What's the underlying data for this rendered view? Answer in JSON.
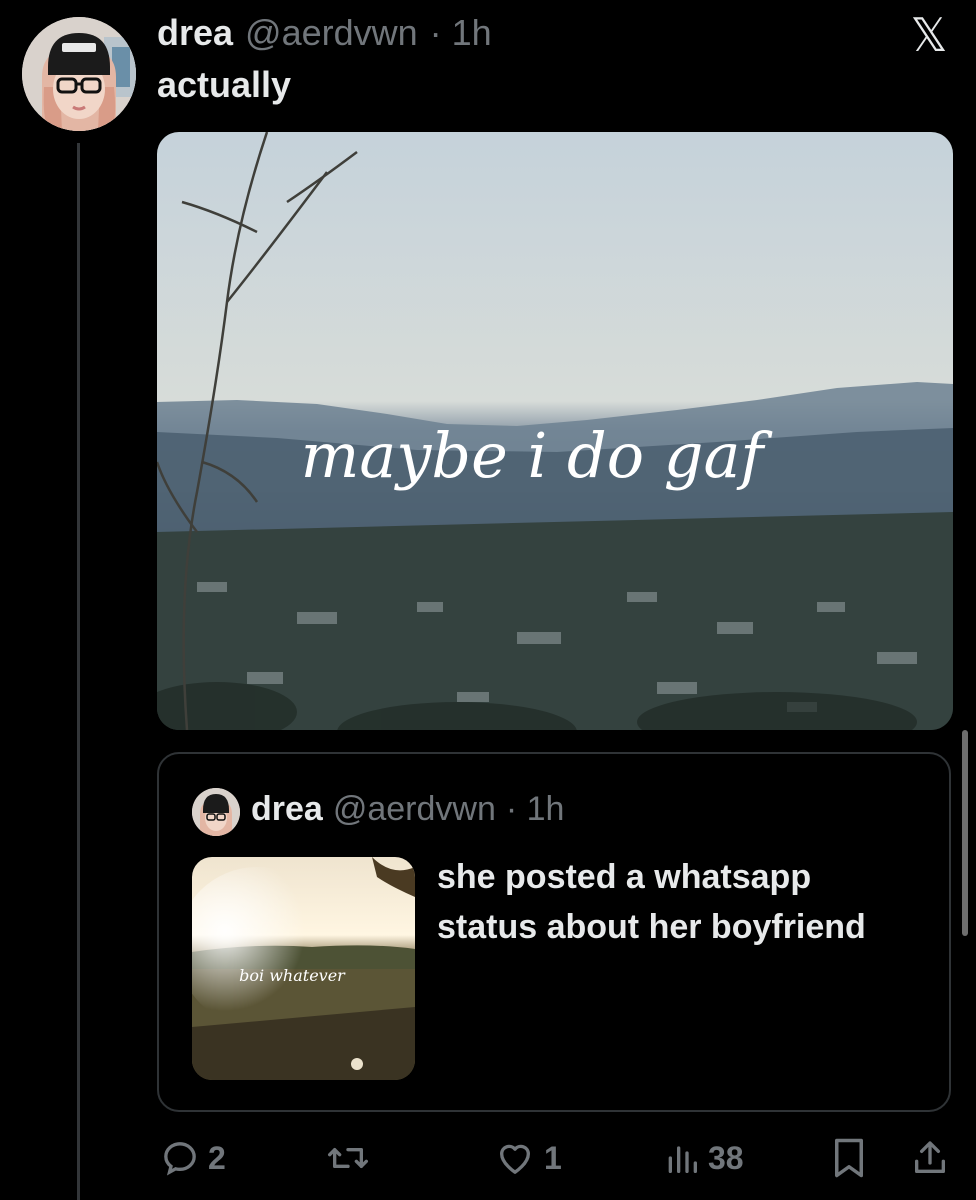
{
  "post": {
    "author_name": "drea",
    "handle": "@aerdvwn",
    "time": "· 1h",
    "text": "actually",
    "media": {
      "overlay_text": "maybe i do gaf"
    }
  },
  "quoted_post": {
    "author_name": "drea",
    "handle": "@aerdvwn",
    "time": "· 1h",
    "thumbnail_text": "boi whatever",
    "text": "she posted a whatsapp status about her boyfriend"
  },
  "actions": {
    "replies": "2",
    "reposts": "",
    "likes": "1",
    "views": "38"
  },
  "icons": {
    "brand": "x-logo-icon",
    "reply": "reply-icon",
    "repost": "repost-icon",
    "like": "heart-icon",
    "views": "views-icon",
    "bookmark": "bookmark-icon",
    "share": "share-icon"
  },
  "colors": {
    "background": "#000000",
    "text": "#e7e9ea",
    "muted": "#71767b",
    "border": "#2f3336"
  }
}
